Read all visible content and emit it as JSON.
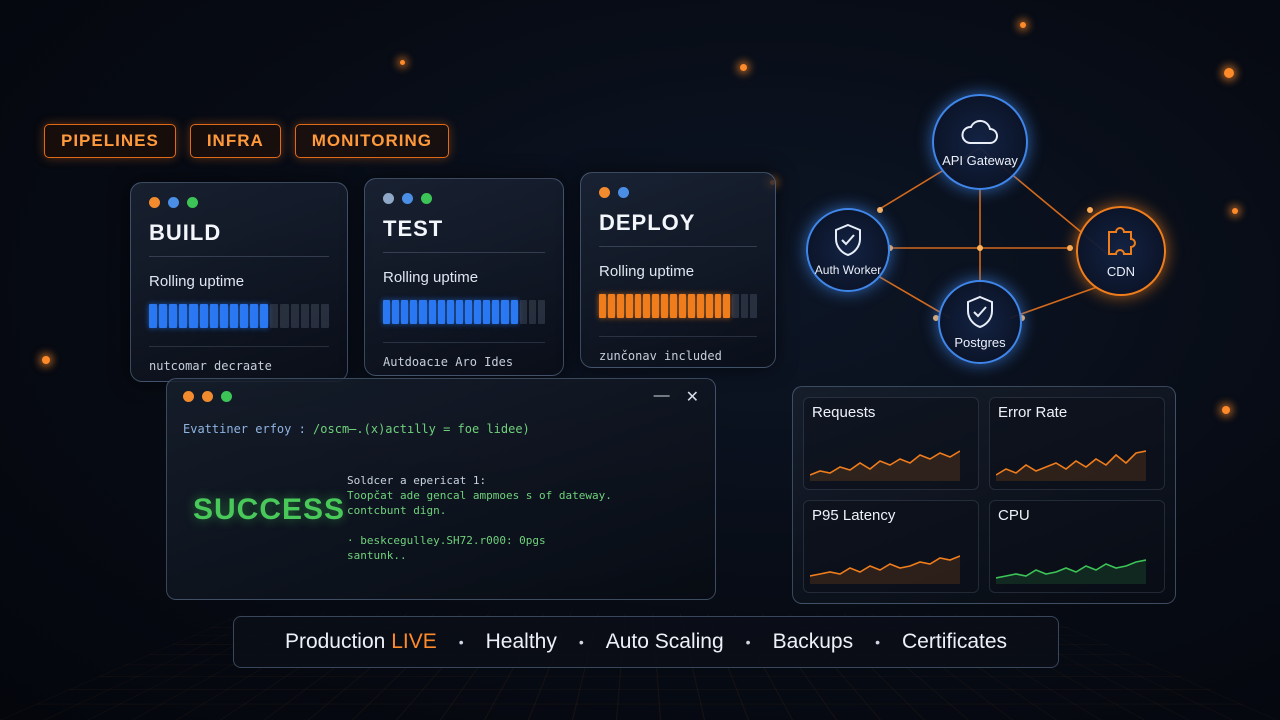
{
  "tabs": [
    "PIPELINES",
    "INFRA",
    "MONITORING"
  ],
  "stages": [
    {
      "title": "BUILD",
      "subtitle": "Rolling uptime",
      "progress": 0.65,
      "color": "#2a78f2",
      "footer": "nutcomar decraate"
    },
    {
      "title": "TEST",
      "subtitle": "Rolling uptime",
      "progress": 0.82,
      "color": "#2a78f2",
      "footer": "Autdoacıe Aro Ides"
    },
    {
      "title": "DEPLOY",
      "subtitle": "Rolling uptime",
      "progress": 0.86,
      "color": "#f07d1c",
      "footer": "zunčonav included"
    }
  ],
  "terminal": {
    "header_prefix": "Evattiner erfoy : ",
    "header_cmd": "/oscm̶.(x)actılly = foe lidee)",
    "status": "SUCCESS",
    "lines": [
      "Soldcer a epericat 1:",
      "Toopčat ade gencal ampmoes s of dateway.",
      "contcbunt dign.",
      "",
      "· beskcegulley.SH72.r000: 0pgs",
      "  santunk.."
    ],
    "minimize": "—",
    "close": "✕"
  },
  "graph": {
    "nodes": {
      "api_gateway": "API Gateway",
      "auth_worker": "Auth Worker",
      "postgres": "Postgres",
      "cdn": "CDN"
    }
  },
  "metrics": [
    {
      "title": "Requests",
      "color": "#f07d1c"
    },
    {
      "title": "Error Rate",
      "color": "#f07d1c"
    },
    {
      "title": "P95 Latency",
      "color": "#f07d1c"
    },
    {
      "title": "CPU",
      "color": "#3cc457"
    }
  ],
  "status_bar": {
    "production": "Production",
    "live": "LIVE",
    "items": [
      "Healthy",
      "Auto Scaling",
      "Backups",
      "Certificates"
    ],
    "separator": "•"
  }
}
